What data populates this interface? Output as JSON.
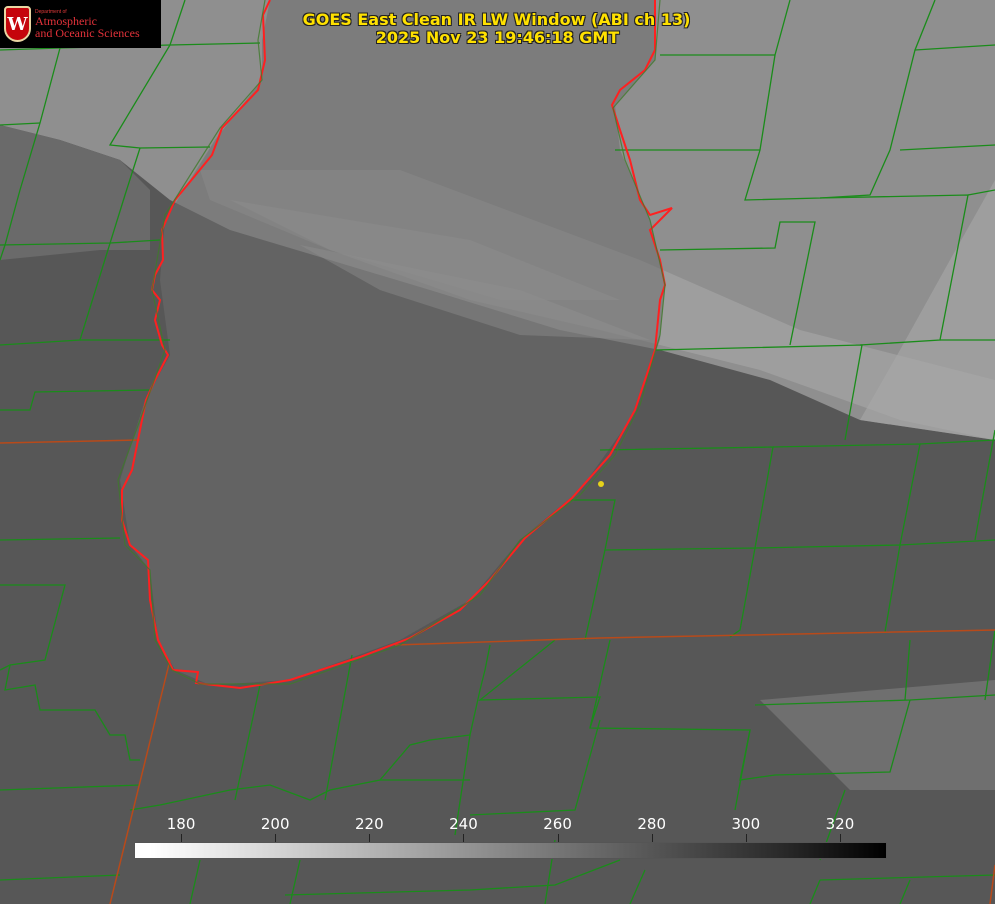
{
  "header": {
    "title_line1": "GOES East Clean IR LW Window (ABI ch 13)",
    "title_line2": "2025 Nov 23 19:46:18 GMT",
    "title_color": "#ffe100"
  },
  "logo": {
    "shield_letter": "W",
    "dept_text": "Department of",
    "line1": "Atmospheric",
    "line2": "and Oceanic Sciences",
    "brand_color": "#c5050c"
  },
  "map": {
    "lake_outline_color": "#ff2020",
    "border_color": "#1a8c1a",
    "state_line_color": "#b84a1a",
    "marker_color": "#e6d21a",
    "background_gray": "#555555"
  },
  "colorbar": {
    "min": 170,
    "max": 330,
    "ticks": [
      "180",
      "200",
      "220",
      "240",
      "260",
      "280",
      "300",
      "320"
    ],
    "tick_values": [
      180,
      200,
      220,
      240,
      260,
      280,
      300,
      320
    ],
    "scale": "brightness temperature, white=cold, black=warm"
  }
}
